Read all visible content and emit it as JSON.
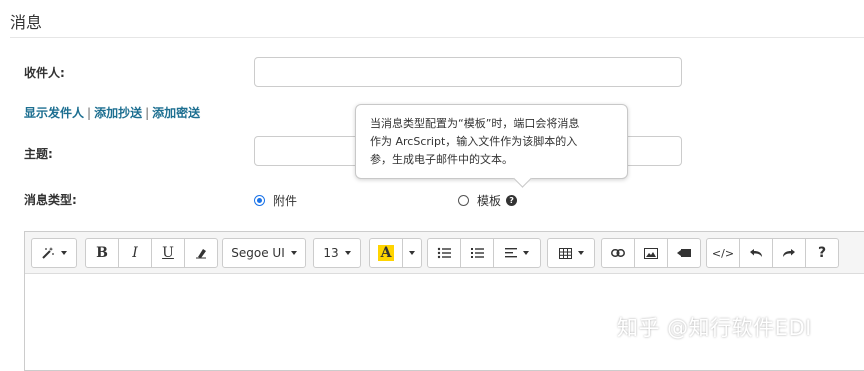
{
  "section": {
    "title": "消息"
  },
  "form": {
    "recipient_label": "收件人:",
    "recipient_value": "",
    "links": {
      "show_sender": "显示发件人",
      "sep": "|",
      "add_cc": "添加抄送",
      "add_bcc": "添加密送"
    },
    "subject_label": "主题:",
    "subject_value": "",
    "message_type_label": "消息类型:",
    "options": {
      "attachment": "附件",
      "template": "模板"
    },
    "selected": "attachment"
  },
  "tooltip": {
    "line1": "当消息类型配置为“模板”时，端口会将消息",
    "line2": "作为 ArcScript，输入文件作为该脚本的入",
    "line3": "参，生成电子邮件中的文本。"
  },
  "toolbar": {
    "font_family": "Segoe UI",
    "font_size": "13",
    "bold": "B",
    "italic": "I",
    "underline": "U",
    "color_letter": "A",
    "help": "?",
    "code": "</>",
    "highlight_color": "#ffd400"
  },
  "watermark": "知乎 @知行软件EDI",
  "colors": {
    "link": "#1d6f91",
    "radio_checked": "#1a73e8"
  }
}
